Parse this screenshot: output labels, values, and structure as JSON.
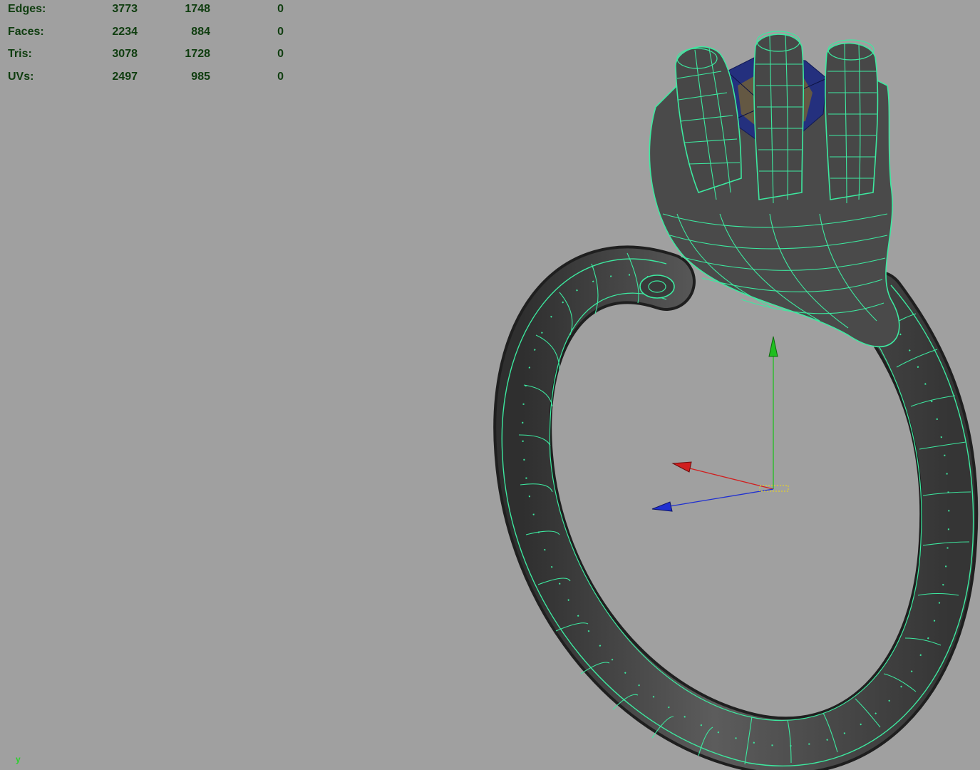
{
  "hud": {
    "rows": [
      {
        "label": "Edges:",
        "values": [
          "3773",
          "1748",
          "0"
        ]
      },
      {
        "label": "Faces:",
        "values": [
          "2234",
          "884",
          "0"
        ]
      },
      {
        "label": "Tris:",
        "values": [
          "3078",
          "1728",
          "0"
        ]
      },
      {
        "label": "UVs:",
        "values": [
          "2497",
          "985",
          "0"
        ]
      }
    ]
  },
  "viewport": {
    "background": "#a0a0a0",
    "wireframe_color": "#3de9a0",
    "mesh_color": "#4a4a4a",
    "gem_color": "#24307e",
    "axis_indicator": "y",
    "manipulator": {
      "x_color": "#d11f1f",
      "y_color": "#1fbf1f",
      "z_color": "#1f2fd1"
    }
  }
}
